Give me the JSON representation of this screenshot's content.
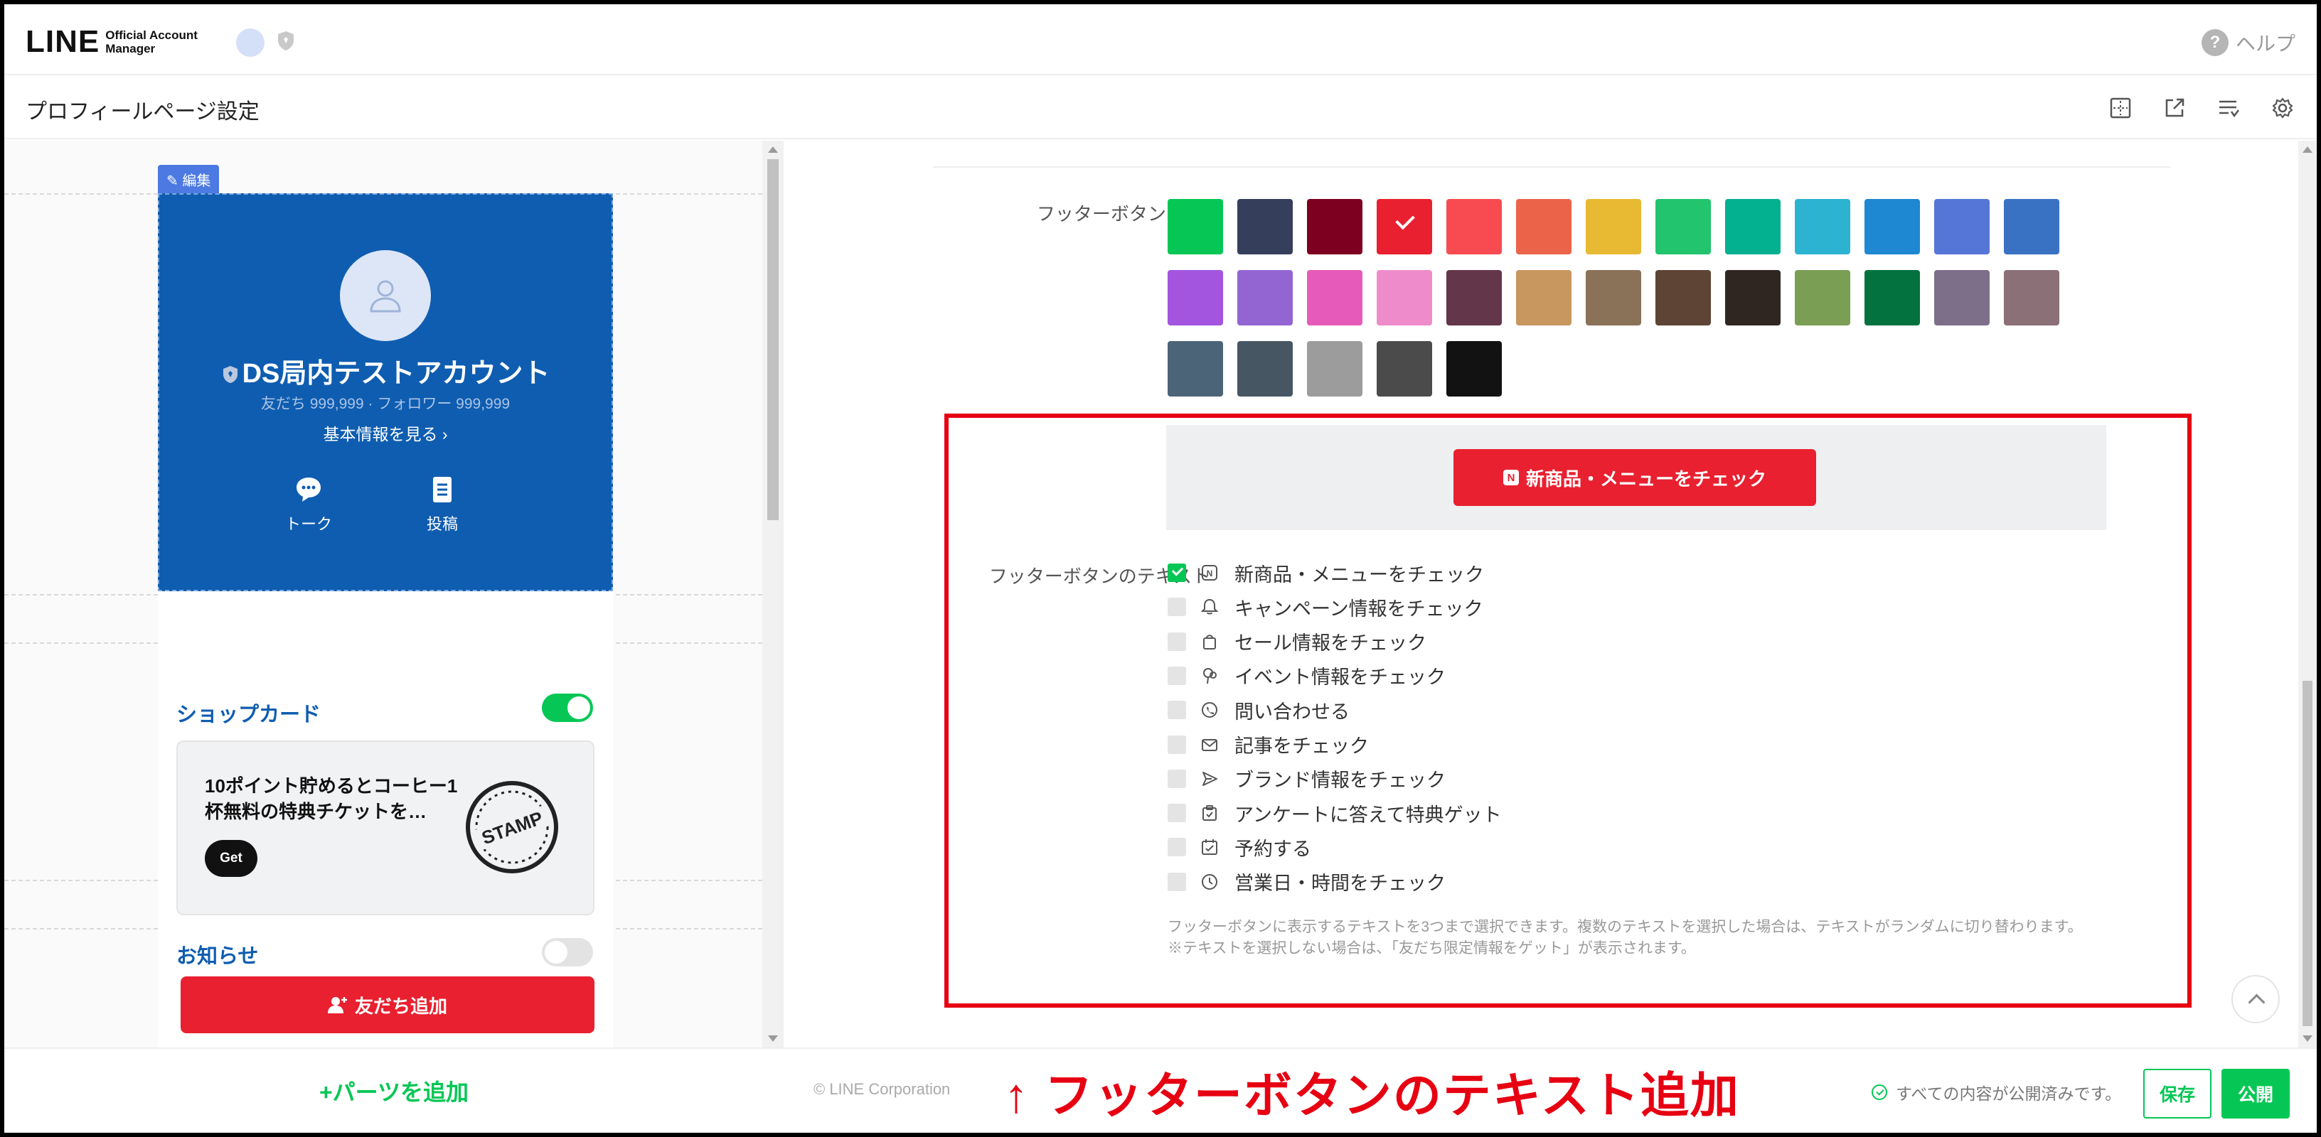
{
  "header": {
    "logo_main": "LINE",
    "logo_sub_1": "Official Account",
    "logo_sub_2": "Manager",
    "help_label": "ヘルプ",
    "help_icon": "question-circle-icon"
  },
  "titlebar": {
    "title": "プロフィールページ設定",
    "tools": [
      "grid-icon",
      "external-link-icon",
      "list-settings-icon",
      "gear-icon"
    ]
  },
  "preview": {
    "edit_tag": "編集",
    "profile": {
      "name": "DS局内テストアカウント",
      "stats": "友だち 999,999 · フォロワー 999,999",
      "info_link": "基本情報を見る ›",
      "actions": [
        {
          "label": "トーク",
          "icon": "chat-icon"
        },
        {
          "label": "投稿",
          "icon": "post-icon"
        }
      ]
    },
    "shopcard": {
      "title": "ショップカード",
      "toggle_on": true,
      "card_text": "10ポイント貯めるとコーヒー1杯無料の特典チケットを…",
      "get_label": "Get",
      "stamp_text": "STAMP"
    },
    "news_title": "お知らせ",
    "add_friend_label": "友だち追加",
    "add_parts_label": "+パーツを追加"
  },
  "settings": {
    "color_label": "フッターボタンの色",
    "color_required": "*",
    "colors": [
      "#06c755",
      "#353f5c",
      "#7d0020",
      "#e8202f",
      "#f74b51",
      "#eb6449",
      "#e8b932",
      "#22c46e",
      "#03b08f",
      "#2db3d2",
      "#1e88d2",
      "#5676d7",
      "#3a72c3",
      "#a455e0",
      "#9265d3",
      "#e65bba",
      "#ee8ccb",
      "#633649",
      "#c8965f",
      "#8a7258",
      "#5d4435",
      "#2f2622",
      "#7a9e54",
      "#03723f",
      "#7d6f89",
      "#8b7078",
      "#4b6478",
      "#465763",
      "#9c9c9c",
      "#4b4b4b",
      "#121212"
    ],
    "selected_color": "#e8202f",
    "preview_button_label": "新商品・メニューをチェック",
    "preview_badge": "N",
    "text_label": "フッターボタンのテキスト",
    "options": [
      {
        "label": "新商品・メニューをチェック",
        "checked": true,
        "icon": "n-badge-icon"
      },
      {
        "label": "キャンペーン情報をチェック",
        "checked": false,
        "icon": "bell-icon"
      },
      {
        "label": "セール情報をチェック",
        "checked": false,
        "icon": "shopping-bag-icon"
      },
      {
        "label": "イベント情報をチェック",
        "checked": false,
        "icon": "balloon-icon"
      },
      {
        "label": "問い合わせる",
        "checked": false,
        "icon": "phone-bubble-icon"
      },
      {
        "label": "記事をチェック",
        "checked": false,
        "icon": "envelope-icon"
      },
      {
        "label": "ブランド情報をチェック",
        "checked": false,
        "icon": "send-icon"
      },
      {
        "label": "アンケートに答えて特典ゲット",
        "checked": false,
        "icon": "survey-icon"
      },
      {
        "label": "予約する",
        "checked": false,
        "icon": "calendar-check-icon"
      },
      {
        "label": "営業日・時間をチェック",
        "checked": false,
        "icon": "clock-icon"
      }
    ],
    "note_1": "フッターボタンに表示するテキストを3つまで選択できます。複数のテキストを選択した場合は、テキストがランダムに切り替わります。",
    "note_2": "※テキストを選択しない場合は、「友だち限定情報をゲット」が表示されます。"
  },
  "footer": {
    "copyright": "© LINE Corporation",
    "annotation": "↑ フッターボタンのテキスト追加",
    "status": "すべての内容が公開済みです。",
    "save_label": "保存",
    "publish_label": "公開"
  }
}
